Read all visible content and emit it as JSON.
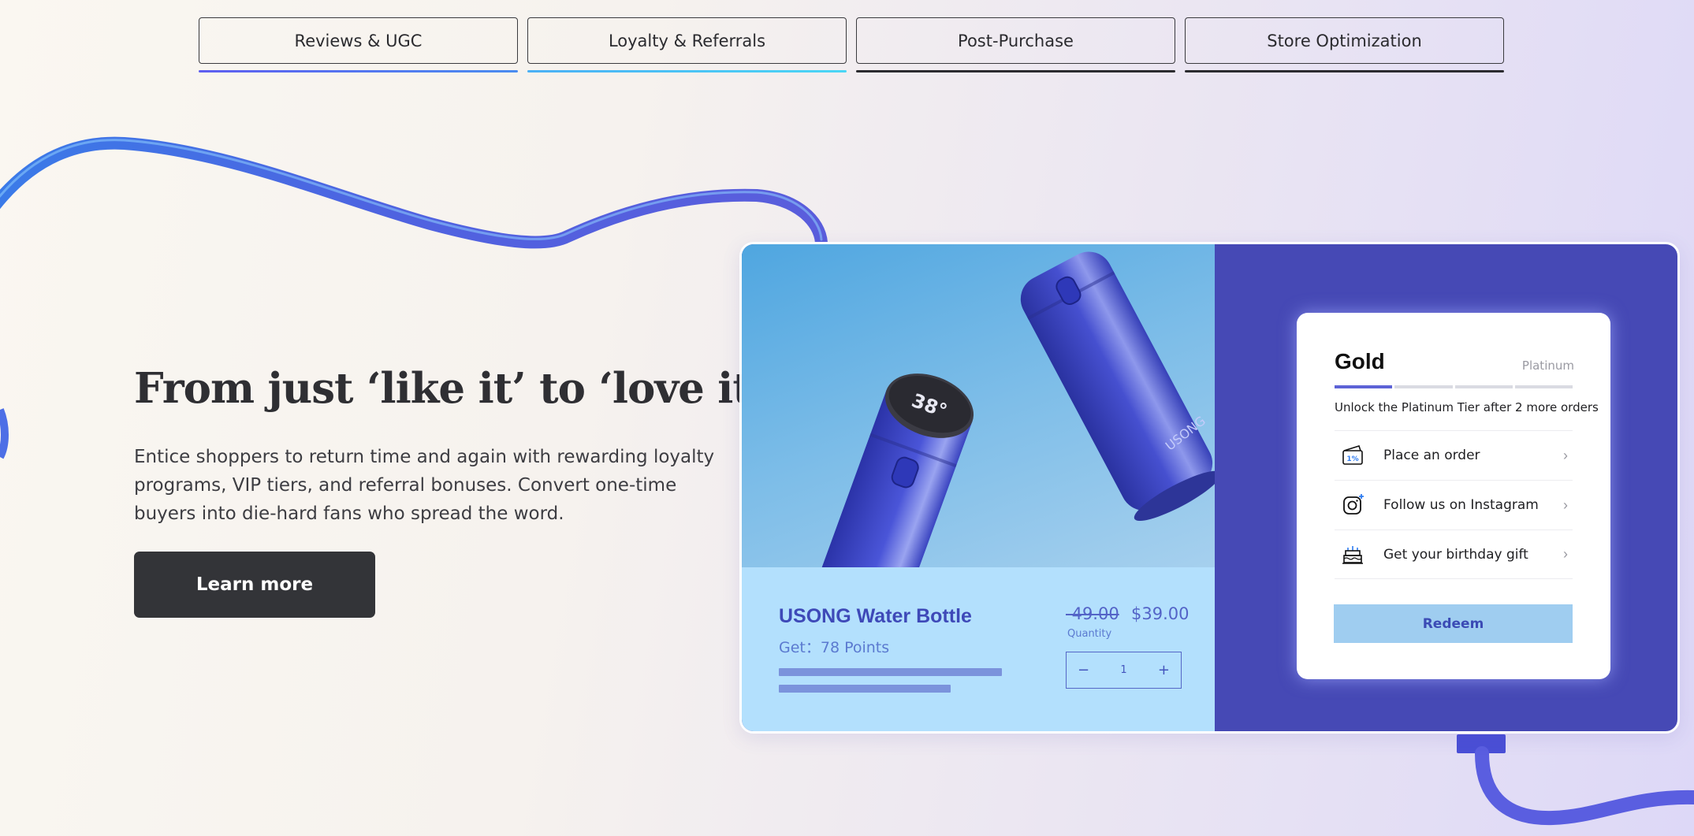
{
  "tabs": [
    {
      "label": "Reviews & UGC"
    },
    {
      "label": "Loyalty & Referrals"
    },
    {
      "label": "Post-Purchase"
    },
    {
      "label": "Store Optimization"
    }
  ],
  "hero": {
    "title": "From just ‘like it’ to ‘love it’",
    "description": "Entice shoppers to return time and again with rewarding loyalty programs, VIP tiers, and referral bonuses. Convert one-time buyers into die-hard fans who spread the word.",
    "cta_label": "Learn more"
  },
  "product": {
    "name": "USONG Water Bottle",
    "points": "Get：78 Points",
    "old_price": "-49.00",
    "price": "$39.00",
    "quantity_label": "Quantity",
    "quantity": "1",
    "minus": "−",
    "plus": "+",
    "display_temp": "38°",
    "brand": "USONG"
  },
  "loyalty": {
    "current_tier": "Gold",
    "next_tier": "Platinum",
    "progress_segments_filled": 1,
    "progress_segments_total": 4,
    "unlock_text": "Unlock the Platinum Tier after 2 more orders",
    "tasks": [
      {
        "label": "Place an order",
        "icon": "coupon-icon"
      },
      {
        "label": "Follow us on Instagram",
        "icon": "instagram-icon"
      },
      {
        "label": "Get your birthday gift",
        "icon": "birthday-cake-icon"
      }
    ],
    "coupon_text": "1%",
    "chevron": "›",
    "redeem_label": "Redeem"
  },
  "colors": {
    "accent": "#4649b5",
    "cta_bg": "#333438",
    "product_name": "#3e49b8",
    "redeem_bg": "#9fcdf0"
  }
}
